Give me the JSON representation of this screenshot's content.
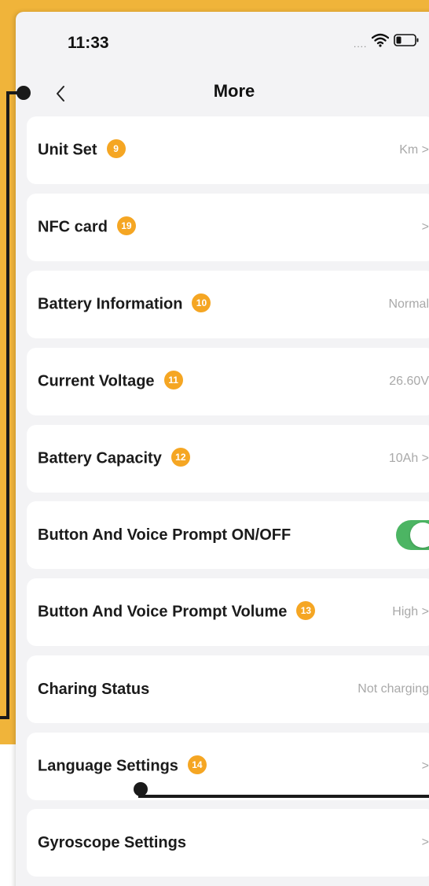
{
  "status_bar": {
    "time": "11:33",
    "signal": "....",
    "wifi_icon": "wifi-icon",
    "battery_icon": "battery-icon"
  },
  "header": {
    "title": "More",
    "back_icon": "chevron-left-icon"
  },
  "colors": {
    "accent_orange": "#f0b43a",
    "badge": "#f5a623",
    "toggle_on": "#4cb563"
  },
  "settings": [
    {
      "label": "Unit Set",
      "badge": "9",
      "value": "Km >"
    },
    {
      "label": "NFC card",
      "badge": "19",
      "value": ">"
    },
    {
      "label": "Battery Information",
      "badge": "10",
      "value": "Normal"
    },
    {
      "label": "Current Voltage",
      "badge": "11",
      "value": "26.60V"
    },
    {
      "label": "Battery Capacity",
      "badge": "12",
      "value": "10Ah >"
    },
    {
      "label": "Button And Voice Prompt ON/OFF",
      "toggle_on": true
    },
    {
      "label": "Button And Voice Prompt Volume",
      "badge": "13",
      "value": "High >"
    },
    {
      "label": "Charing Status",
      "value": "Not charging"
    },
    {
      "label": "Language Settings",
      "badge": "14",
      "value": ">"
    },
    {
      "label": "Gyroscope Settings",
      "value": ">"
    }
  ]
}
